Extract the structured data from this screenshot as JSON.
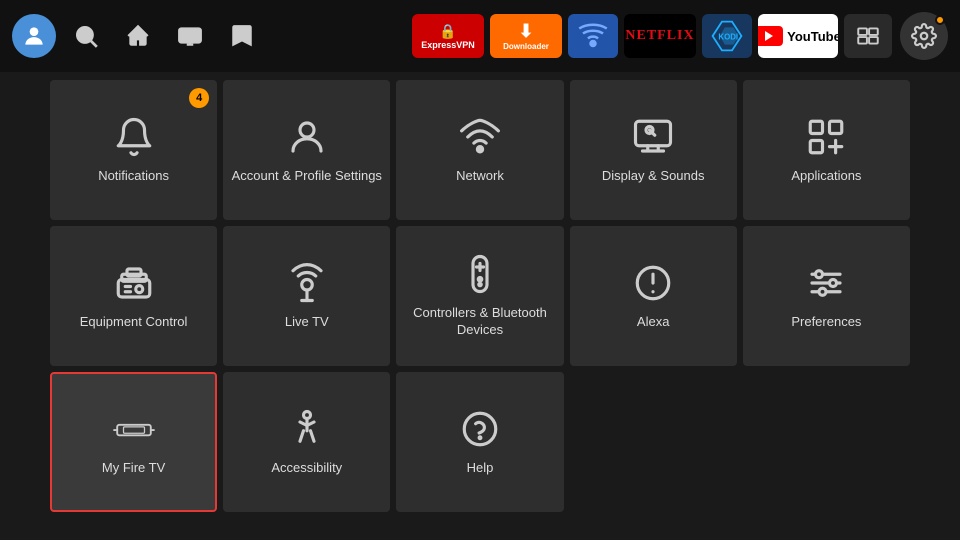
{
  "topNav": {
    "avatarIcon": "👤",
    "searchLabel": "Search",
    "homeLabel": "Home",
    "tvLabel": "Live TV",
    "bookmarkLabel": "Bookmarks",
    "apps": [
      {
        "name": "ExpressVPN",
        "type": "expressvpn",
        "label": "ExpressVPN"
      },
      {
        "name": "Downloader",
        "type": "downloader",
        "label": "Downloader ↓"
      },
      {
        "name": "Generic Blue",
        "type": "generic-blue",
        "label": "🔵"
      },
      {
        "name": "Netflix",
        "type": "netflix",
        "label": "NETFLIX"
      },
      {
        "name": "Kodi",
        "type": "kodi",
        "label": "KODI"
      },
      {
        "name": "YouTube",
        "type": "youtube"
      },
      {
        "name": "Mirroring",
        "type": "mirroring",
        "label": "⊞"
      }
    ],
    "settingsBadge": ""
  },
  "grid": {
    "items": [
      {
        "id": "notifications",
        "label": "Notifications",
        "badge": "4",
        "selected": false
      },
      {
        "id": "account-profile",
        "label": "Account & Profile Settings",
        "badge": "",
        "selected": false
      },
      {
        "id": "network",
        "label": "Network",
        "badge": "",
        "selected": false
      },
      {
        "id": "display-sounds",
        "label": "Display & Sounds",
        "badge": "",
        "selected": false
      },
      {
        "id": "applications",
        "label": "Applications",
        "badge": "",
        "selected": false
      },
      {
        "id": "equipment-control",
        "label": "Equipment Control",
        "badge": "",
        "selected": false
      },
      {
        "id": "live-tv",
        "label": "Live TV",
        "badge": "",
        "selected": false
      },
      {
        "id": "controllers-bluetooth",
        "label": "Controllers & Bluetooth Devices",
        "badge": "",
        "selected": false
      },
      {
        "id": "alexa",
        "label": "Alexa",
        "badge": "",
        "selected": false
      },
      {
        "id": "preferences",
        "label": "Preferences",
        "badge": "",
        "selected": false
      },
      {
        "id": "my-fire-tv",
        "label": "My Fire TV",
        "badge": "",
        "selected": true
      },
      {
        "id": "accessibility",
        "label": "Accessibility",
        "badge": "",
        "selected": false
      },
      {
        "id": "help",
        "label": "Help",
        "badge": "",
        "selected": false
      }
    ]
  }
}
